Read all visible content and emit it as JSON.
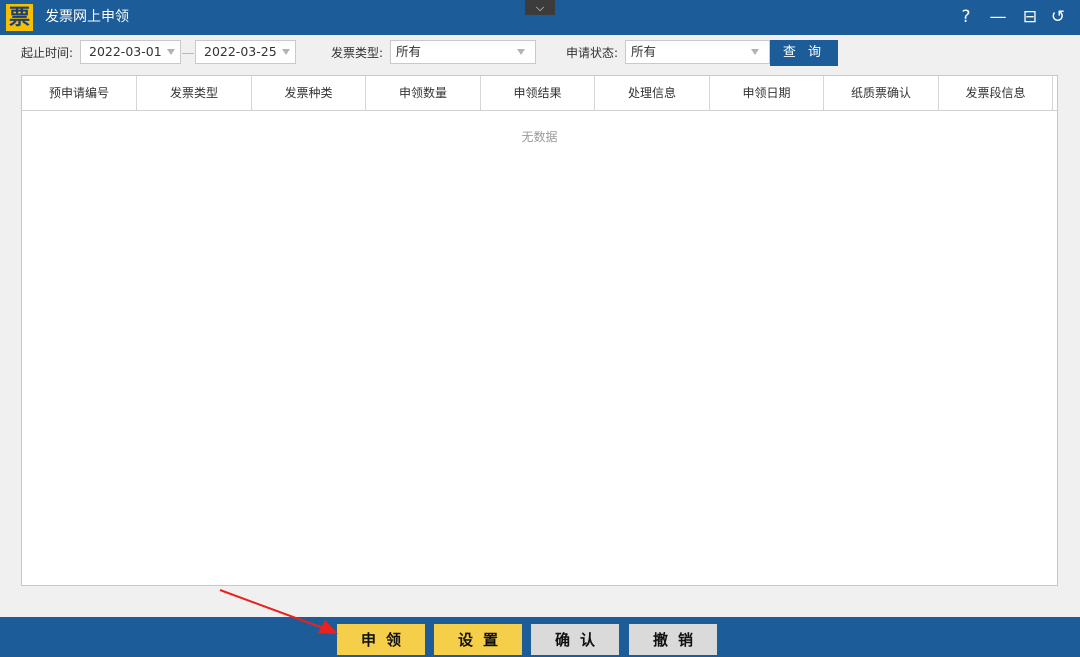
{
  "window": {
    "logo_glyph": "票",
    "title": "发票网上申领",
    "help_glyph": "?",
    "minimize_glyph": "—",
    "restore_glyph": "⊟",
    "back_glyph": "↺",
    "collapse_glyph": "⌵"
  },
  "filters": {
    "date_label": "起止时间:",
    "start_date": "2022-03-01",
    "end_date": "2022-03-25",
    "type_label": "发票类型:",
    "type_value": "所有",
    "status_label": "申请状态:",
    "status_value": "所有",
    "query_button": "查 询"
  },
  "table": {
    "columns": [
      "预申请编号",
      "发票类型",
      "发票种类",
      "申领数量",
      "申领结果",
      "处理信息",
      "申领日期",
      "纸质票确认",
      "发票段信息"
    ],
    "rows": [],
    "empty_text": "无数据"
  },
  "actions": {
    "apply": "申领",
    "settings": "设置",
    "confirm": "确认",
    "revoke": "撤销"
  },
  "colors": {
    "brand_blue": "#1b5c99",
    "button_yellow": "#f5cf4a",
    "button_grey": "#dadada",
    "annotation_red": "#e8231f"
  }
}
